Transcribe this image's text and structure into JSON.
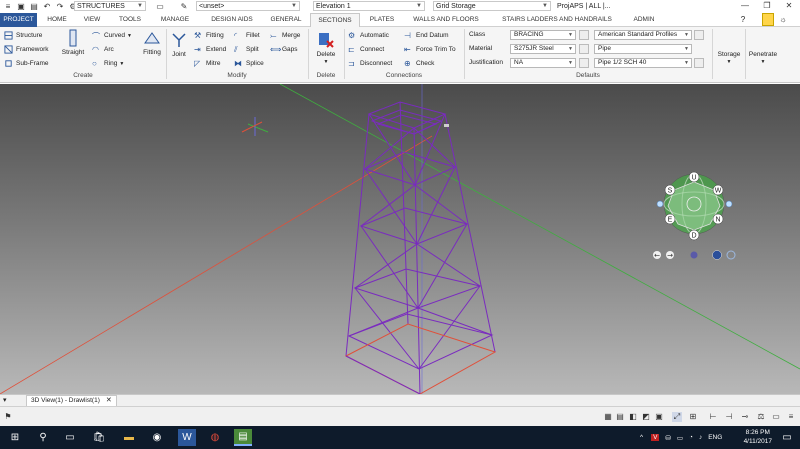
{
  "quick_access": {
    "workspace": "STRUCTURES",
    "layer": "<unset>",
    "elevation": "Elevation 1",
    "grid": "Grid Storage",
    "project": "ProjAPS | ALL |..."
  },
  "tabs": [
    "PROJECT",
    "HOME",
    "VIEW",
    "TOOLS",
    "MANAGE",
    "DESIGN AIDS",
    "GENERAL",
    "SECTIONS",
    "PLATES",
    "WALLS AND FLOORS",
    "STAIRS LADDERS AND HANDRAILS",
    "ADMIN"
  ],
  "active_tab": "SECTIONS",
  "ribbon": {
    "create": {
      "structure": "Structure",
      "framework": "Framework",
      "subframe": "Sub-Frame",
      "straight": "Straight",
      "curved": "Curved",
      "arc": "Arc",
      "ring": "Ring",
      "fitting": "Fitting",
      "label": "Create"
    },
    "modify": {
      "joint": "Joint",
      "fitting": "Fitting",
      "fillet": "Fillet",
      "merge": "Merge",
      "extend": "Extend",
      "split": "Split",
      "gaps": "Gaps",
      "mitre": "Mitre",
      "splice": "Splice",
      "label": "Modify"
    },
    "delete": {
      "button": "Delete",
      "label": "Delete"
    },
    "connections": {
      "automatic": "Automatic",
      "connect": "Connect",
      "disconnect": "Disconnect",
      "end_datum": "End Datum",
      "force_trim": "Force Trim To",
      "check": "Check",
      "label": "Connections"
    },
    "defaults": {
      "class_label": "Class",
      "class_value": "BRACING",
      "material_label": "Material",
      "material_value": "S275JR Steel",
      "justification_label": "Justification",
      "justification_value": "NA",
      "profile_std": "American Standard Profiles",
      "profile_type": "Pipe",
      "profile_size": "Pipe 1/2 SCH 40",
      "label": "Defaults"
    },
    "storage": "Storage",
    "penetrate": "Penetrate"
  },
  "viewcube": {
    "u": "U",
    "d": "D",
    "n": "N",
    "s": "S",
    "e": "E",
    "w": "W"
  },
  "doc_tab": "3D View(1) - Drawlist(1)",
  "taskbar": {
    "time": "8:26 PM",
    "date": "4/11/2017",
    "lang": "ENG"
  },
  "colors": {
    "accent": "#2b579a",
    "structure": "#7a2bbf",
    "axis_red": "#e0503a",
    "axis_green": "#3fae3f"
  }
}
